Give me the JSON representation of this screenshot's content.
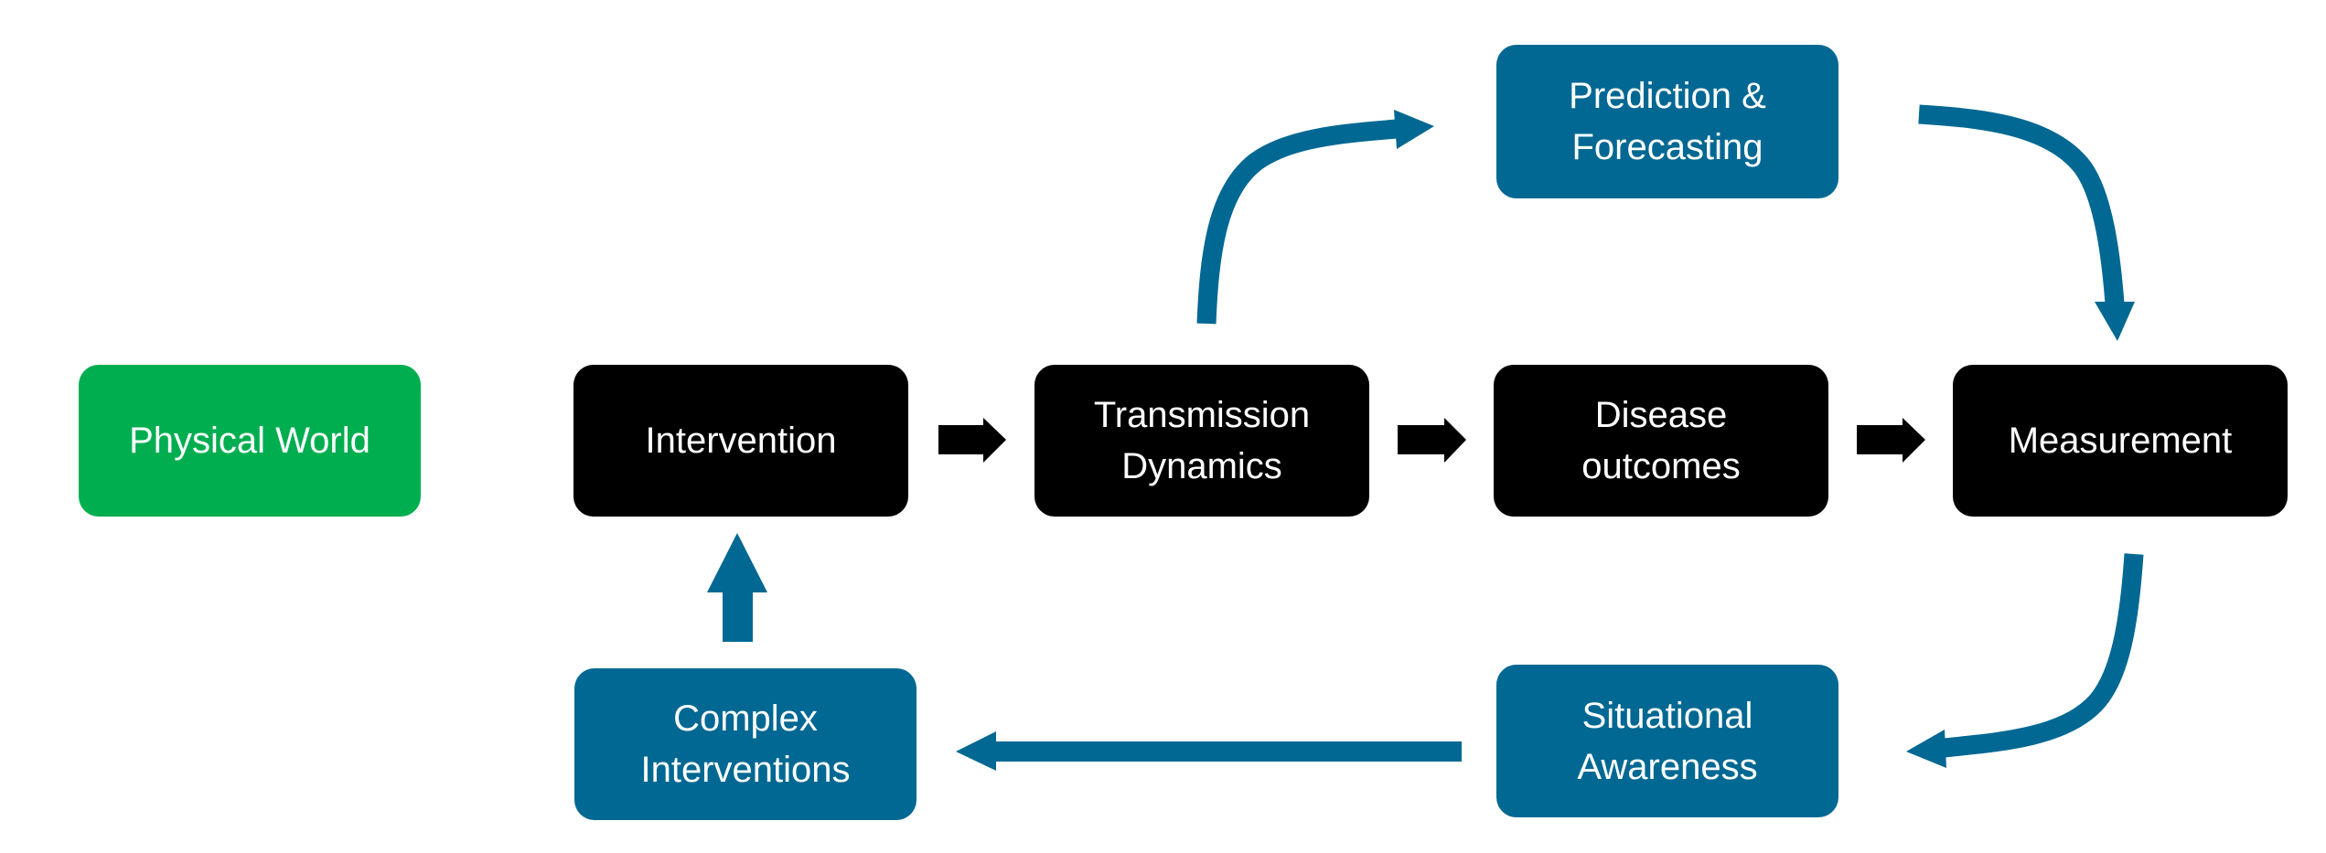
{
  "diagram": {
    "colors": {
      "physical": "#00ae50",
      "core": "#000000",
      "feedback": "#006892",
      "text": "#ffffff"
    },
    "nodes": {
      "physical_world": "Physical World",
      "intervention": "Intervention",
      "transmission_dynamics": "Transmission\nDynamics",
      "disease_outcomes": "Disease\noutcomes",
      "measurement": "Measurement",
      "prediction_forecasting": "Prediction &\nForecasting",
      "situational_awareness": "Situational\nAwareness",
      "complex_interventions": "Complex\nInterventions"
    },
    "edges": [
      {
        "from": "Intervention",
        "to": "Transmission Dynamics",
        "style": "straight-black"
      },
      {
        "from": "Transmission Dynamics",
        "to": "Disease outcomes",
        "style": "straight-black"
      },
      {
        "from": "Disease outcomes",
        "to": "Measurement",
        "style": "straight-black"
      },
      {
        "from": "Transmission Dynamics",
        "to": "Prediction & Forecasting",
        "style": "curved-blue"
      },
      {
        "from": "Prediction & Forecasting",
        "to": "Measurement",
        "style": "curved-blue"
      },
      {
        "from": "Measurement",
        "to": "Situational Awareness",
        "style": "curved-blue"
      },
      {
        "from": "Situational Awareness",
        "to": "Complex Interventions",
        "style": "straight-blue"
      },
      {
        "from": "Complex Interventions",
        "to": "Intervention",
        "style": "straight-blue"
      }
    ]
  }
}
